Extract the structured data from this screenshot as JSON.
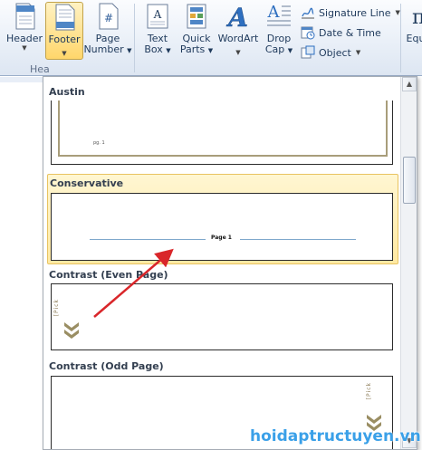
{
  "ribbon": {
    "buttons": [
      {
        "label": "Header",
        "label2": ""
      },
      {
        "label": "Footer",
        "label2": ""
      },
      {
        "label": "Page",
        "label2": "Number"
      },
      {
        "label": "Text",
        "label2": "Box"
      },
      {
        "label": "Quick",
        "label2": "Parts"
      },
      {
        "label": "WordArt",
        "label2": ""
      },
      {
        "label": "Drop",
        "label2": "Cap"
      },
      {
        "label": "Equ",
        "label2": ""
      }
    ],
    "small_buttons": [
      {
        "label": "Signature Line"
      },
      {
        "label": "Date & Time"
      },
      {
        "label": "Object"
      }
    ],
    "group_label": "Hea"
  },
  "gallery": {
    "items": [
      {
        "title": "Austin",
        "thumb_text": "pg. 1"
      },
      {
        "title": "Conservative",
        "thumb_text": "Page 1"
      },
      {
        "title": "Contrast (Even Page)",
        "thumb_text": "[Pick"
      },
      {
        "title": "Contrast (Odd Page)",
        "thumb_text": "[Pick"
      }
    ],
    "selected_index": 1
  },
  "watermark": "hoidaptructuyen.vn",
  "colors": {
    "accent": "#ffd66b",
    "selection_border": "#e8c360",
    "austin_frame": "#a89d7a",
    "conservative_line": "#7fa8cc",
    "arrow": "#d9262a",
    "watermark": "#3aa0e8"
  }
}
